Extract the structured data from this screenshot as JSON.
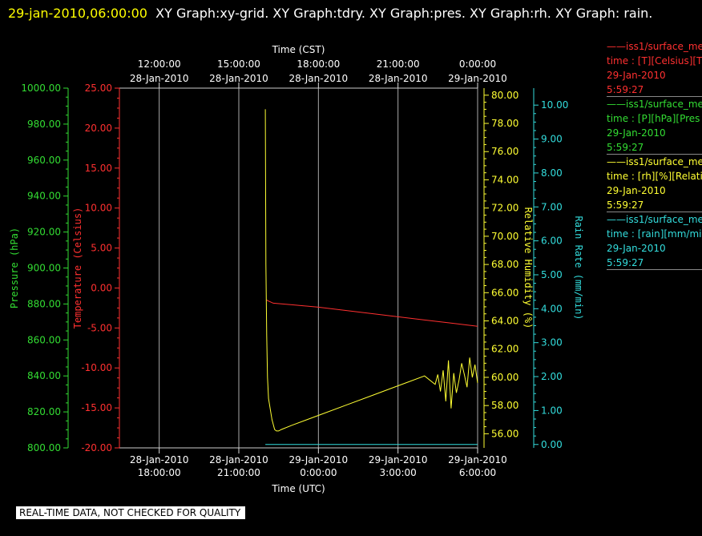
{
  "title": {
    "timestamp": "29-jan-2010,06:00:00",
    "rest": "XY Graph:xy-grid.  XY Graph:tdry.  XY Graph:pres.  XY Graph:rh.  XY Graph: rain."
  },
  "legend": [
    {
      "series": "——iss1/surface_me",
      "var": "time : [T][Celsius][T",
      "date": "29-Jan-2010",
      "time": "5:59:27",
      "color": "#ff3030"
    },
    {
      "series": "——iss1/surface_me",
      "var": "time : [P][hPa][Pres",
      "date": "29-Jan-2010",
      "time": "5:59:27",
      "color": "#33dd33"
    },
    {
      "series": "——iss1/surface_me",
      "var": "time : [rh][%][Relati",
      "date": "29-Jan-2010",
      "time": "5:59:27",
      "color": "#ffff33"
    },
    {
      "series": "——iss1/surface_me",
      "var": "time : [rain][mm/min",
      "date": "29-Jan-2010",
      "time": "5:59:27",
      "color": "#33dddd"
    }
  ],
  "banner": "REAL-TIME DATA, NOT CHECKED FOR QUALITY",
  "chart_data": {
    "type": "line",
    "grid": true,
    "x_unit": "hours",
    "xlim": [
      16.5,
      30.0
    ],
    "top_axis": {
      "label": "Time (CST)",
      "ticks": [
        {
          "x": 18,
          "l1": "12:00:00",
          "l2": "28-Jan-2010"
        },
        {
          "x": 21,
          "l1": "15:00:00",
          "l2": "28-Jan-2010"
        },
        {
          "x": 24,
          "l1": "18:00:00",
          "l2": "28-Jan-2010"
        },
        {
          "x": 27,
          "l1": "21:00:00",
          "l2": "28-Jan-2010"
        },
        {
          "x": 30,
          "l1": "0:00:00",
          "l2": "29-Jan-2010"
        }
      ]
    },
    "bottom_axis": {
      "label": "Time (UTC)",
      "ticks": [
        {
          "x": 18,
          "l1": "28-Jan-2010",
          "l2": "18:00:00"
        },
        {
          "x": 21,
          "l1": "28-Jan-2010",
          "l2": "21:00:00"
        },
        {
          "x": 24,
          "l1": "29-Jan-2010",
          "l2": "0:00:00"
        },
        {
          "x": 27,
          "l1": "29-Jan-2010",
          "l2": "3:00:00"
        },
        {
          "x": 30,
          "l1": "29-Jan-2010",
          "l2": "6:00:00"
        }
      ]
    },
    "axes": {
      "pres": {
        "label": "Pressure (hPa)",
        "ylim": [
          800,
          1000
        ],
        "step": 20,
        "decimals": 2,
        "color": "#33dd33"
      },
      "tdry": {
        "label": "Temperature (Celsius)",
        "ylim": [
          -20,
          25
        ],
        "step": 5,
        "decimals": 2,
        "color": "#ff3030"
      },
      "rh": {
        "label": "Relative Humidity (%)",
        "ylim": [
          55,
          80.5
        ],
        "step": 2,
        "first": 56,
        "decimals": 2,
        "color": "#ffff33"
      },
      "rain": {
        "label": "Rain Rate (mm/min)",
        "ylim": [
          -0.1,
          10.5
        ],
        "step": 1,
        "first": 0,
        "decimals": 2,
        "color": "#33dddd"
      }
    },
    "series": [
      {
        "name": "tdry",
        "axis": "tdry",
        "x": [
          22.05,
          22.1,
          22.3,
          23.0,
          24.0,
          25.0,
          26.0,
          27.0,
          28.0,
          29.0,
          30.0
        ],
        "y": [
          -1.5,
          -1.6,
          -1.9,
          -2.1,
          -2.4,
          -2.8,
          -3.2,
          -3.6,
          -4.0,
          -4.4,
          -4.8
        ]
      },
      {
        "name": "rh",
        "axis": "rh",
        "x": [
          22.0,
          22.02,
          22.05,
          22.08,
          22.12,
          22.18,
          22.25,
          22.35,
          22.42,
          22.5,
          22.6,
          23.0,
          24.0,
          25.0,
          26.0,
          27.0,
          28.0,
          28.4,
          28.5,
          28.6,
          28.7,
          28.8,
          28.9,
          29.0,
          29.1,
          29.2,
          29.3,
          29.4,
          29.5,
          29.6,
          29.7,
          29.8,
          29.9,
          30.0
        ],
        "y": [
          79.0,
          68.0,
          63.0,
          60.0,
          58.5,
          57.8,
          57.0,
          56.3,
          56.2,
          56.2,
          56.3,
          56.6,
          57.3,
          58.0,
          58.7,
          59.4,
          60.1,
          59.5,
          60.2,
          59.0,
          60.5,
          58.3,
          61.2,
          57.8,
          60.3,
          58.9,
          59.8,
          61.0,
          60.2,
          59.3,
          61.4,
          60.0,
          60.9,
          59.6
        ]
      },
      {
        "name": "pres",
        "axis": "pres",
        "x": [
          16.5,
          30.0
        ],
        "y": [
          800,
          800
        ]
      },
      {
        "name": "rain",
        "axis": "rain",
        "x": [
          22.0,
          30.0
        ],
        "y": [
          0.0,
          0.0
        ]
      }
    ]
  }
}
